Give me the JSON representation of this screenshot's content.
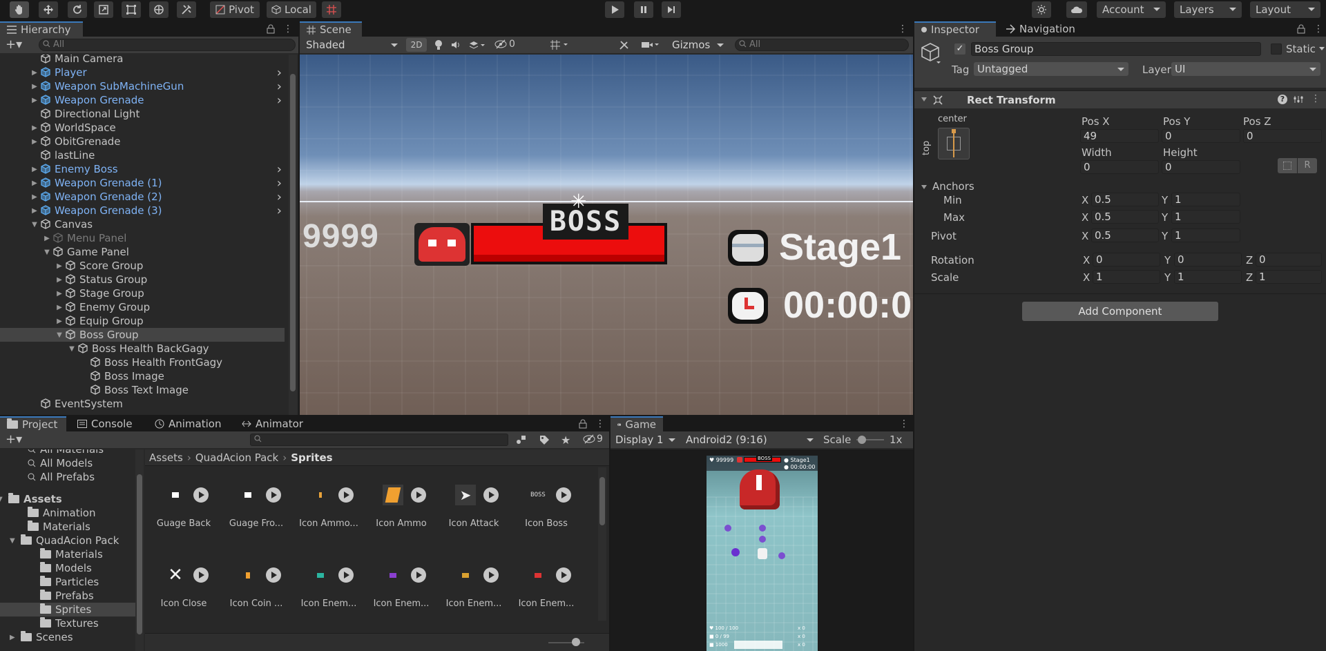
{
  "toolbar": {
    "pivot_label": "Pivot",
    "local_label": "Local",
    "account_label": "Account",
    "layers_label": "Layers",
    "layout_label": "Layout"
  },
  "hierarchy": {
    "tab_label": "Hierarchy",
    "search_placeholder": "All",
    "rows": [
      {
        "label": "Main Camera"
      },
      {
        "label": "Player"
      },
      {
        "label": "Weapon SubMachineGun"
      },
      {
        "label": "Weapon Grenade"
      },
      {
        "label": "Directional Light"
      },
      {
        "label": "WorldSpace"
      },
      {
        "label": "ObitGrenade"
      },
      {
        "label": "lastLine"
      },
      {
        "label": "Enemy Boss"
      },
      {
        "label": "Weapon Grenade (1)"
      },
      {
        "label": "Weapon Grenade (2)"
      },
      {
        "label": "Weapon Grenade (3)"
      },
      {
        "label": "Canvas"
      },
      {
        "label": "Menu Panel"
      },
      {
        "label": "Game Panel"
      },
      {
        "label": "Score Group"
      },
      {
        "label": "Status Group"
      },
      {
        "label": "Stage Group"
      },
      {
        "label": "Enemy Group"
      },
      {
        "label": "Equip Group"
      },
      {
        "label": "Boss Group"
      },
      {
        "label": "Boss Health BackGagy"
      },
      {
        "label": "Boss Health FrontGagy"
      },
      {
        "label": "Boss Image"
      },
      {
        "label": "Boss Text Image"
      },
      {
        "label": "EventSystem"
      }
    ]
  },
  "scene": {
    "tab_label": "Scene",
    "shading": "Shaded",
    "mode_2d": "2D",
    "hidden_count": "0",
    "gizmos_label": "Gizmos",
    "search_placeholder": "All",
    "score_text": "9999",
    "boss_text": "BOSS",
    "stage_text": "Stage1",
    "timer_text": "00:00:0"
  },
  "inspector": {
    "tab_label": "Inspector",
    "nav_tab_label": "Navigation",
    "object_name": "Boss Group",
    "static_label": "Static",
    "tag_label": "Tag",
    "tag_value": "Untagged",
    "layer_label": "Layer",
    "layer_value": "UI",
    "component_title": "Rect Transform",
    "anchor_h": "center",
    "anchor_v": "top",
    "pos_x_label": "Pos X",
    "pos_y_label": "Pos Y",
    "pos_z_label": "Pos Z",
    "pos_x": "49",
    "pos_y": "0",
    "pos_z": "0",
    "width_label": "Width",
    "height_label": "Height",
    "width": "0",
    "height": "0",
    "r_button": "R",
    "anchors_label": "Anchors",
    "min_label": "Min",
    "max_label": "Max",
    "pivot_label": "Pivot",
    "rotation_label": "Rotation",
    "scale_label": "Scale",
    "x_axis": "X",
    "y_axis": "Y",
    "z_axis": "Z",
    "min_x": "0.5",
    "min_y": "1",
    "max_x": "0.5",
    "max_y": "1",
    "pivot_x": "0.5",
    "pivot_y": "1",
    "rot_x": "0",
    "rot_y": "0",
    "rot_z": "0",
    "scale_x": "1",
    "scale_y": "1",
    "scale_z": "1",
    "add_component": "Add Component"
  },
  "project": {
    "tabs": [
      "Project",
      "Console",
      "Animation",
      "Animator"
    ],
    "hidden_count": "9",
    "tree": [
      {
        "label": "All Materials"
      },
      {
        "label": "All Models"
      },
      {
        "label": "All Prefabs"
      },
      {
        "label": "Assets"
      },
      {
        "label": "Animation"
      },
      {
        "label": "Materials"
      },
      {
        "label": "QuadAcion Pack"
      },
      {
        "label": "Materials"
      },
      {
        "label": "Models"
      },
      {
        "label": "Particles"
      },
      {
        "label": "Prefabs"
      },
      {
        "label": "Sprites"
      },
      {
        "label": "Textures"
      },
      {
        "label": "Scenes"
      }
    ],
    "breadcrumb": [
      "Assets",
      "QuadAcion Pack",
      "Sprites"
    ],
    "assets_row1": [
      "Guage Back",
      "Guage Fro...",
      "Icon Ammo...",
      "Icon Ammo",
      "Icon Attack",
      "Icon Boss"
    ],
    "assets_row2": [
      "Icon Close",
      "Icon Coin ...",
      "Icon Enem...",
      "Icon Enem...",
      "Icon Enem...",
      "Icon Enem..."
    ],
    "boss_icon_text": "BOSS"
  },
  "game": {
    "tab_label": "Game",
    "display": "Display 1",
    "resolution": "Android2 (9:16)",
    "scale_label": "Scale",
    "scale_value": "1x",
    "hud_score": "99999",
    "hud_stage": "Stage1",
    "hud_time": "00:00:00",
    "hud_hp": "100 / 100",
    "hud_ammo": "0 / 99",
    "hud_coin": "1000",
    "hud_x1": "x 0",
    "hud_x2": "x 0",
    "hud_x3": "x 0"
  }
}
